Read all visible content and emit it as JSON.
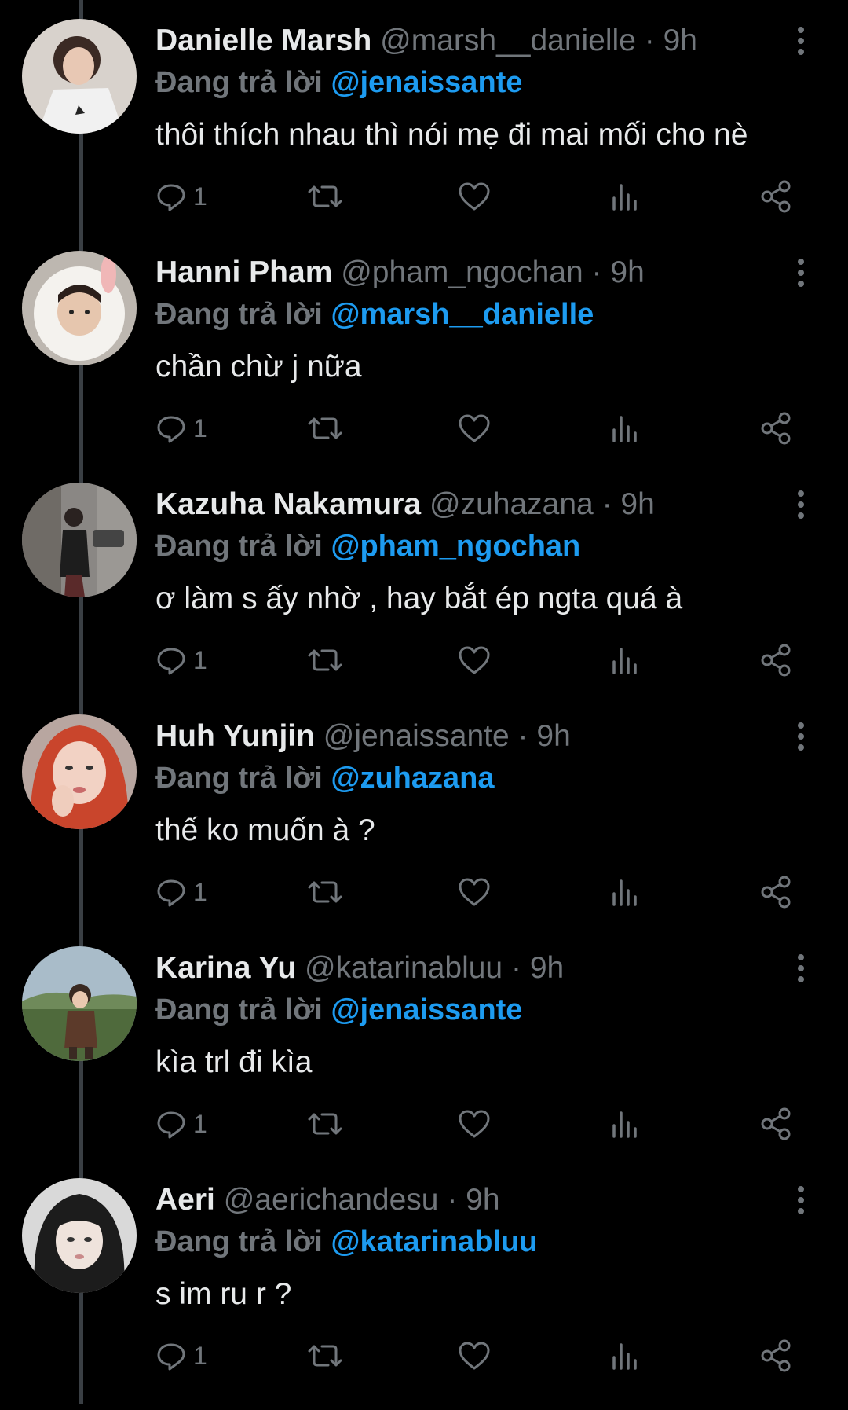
{
  "colors": {
    "background": "#000000",
    "text": "#e7e9ea",
    "muted": "#71767b",
    "accent": "#1d9bf0",
    "thread_line": "#3a3f44"
  },
  "replying_prefix": "Đang trả lời",
  "tweets": [
    {
      "name": "Danielle Marsh",
      "handle": "@marsh__danielle",
      "dot": "·",
      "time": "9h",
      "reply_to": "@jenaissante",
      "text": "thôi thích nhau thì nói mẹ đi mai mối cho nè",
      "reply_count": "1"
    },
    {
      "name": "Hanni Pham",
      "handle": "@pham_ngochan",
      "dot": "·",
      "time": "9h",
      "reply_to": "@marsh__danielle",
      "text": "chần chừ j nữa",
      "reply_count": "1"
    },
    {
      "name": "Kazuha Nakamura",
      "handle": "@zuhazana",
      "dot": "·",
      "time": "9h",
      "reply_to": "@pham_ngochan",
      "text": "ơ làm s ấy nhờ , hay bắt ép ngta quá à",
      "reply_count": "1"
    },
    {
      "name": "Huh Yunjin",
      "handle": " @jenaissante",
      "dot": "·",
      "time": "9h",
      "reply_to": "@zuhazana",
      "text": "thế ko muốn à ?",
      "reply_count": "1"
    },
    {
      "name": "Karina Yu",
      "handle": "@katarinabluu",
      "dot": "·",
      "time": "9h",
      "reply_to": "@jenaissante",
      "text": "kìa trl đi kìa",
      "reply_count": "1"
    },
    {
      "name": "Aeri",
      "handle": "@aerichandesu",
      "dot": "·",
      "time": "9h",
      "reply_to": "@katarinabluu",
      "text": "s im ru r ?",
      "reply_count": "1"
    }
  ],
  "icons": {
    "reply": "reply-icon",
    "retweet": "retweet-icon",
    "like": "heart-icon",
    "views": "views-chart-icon",
    "share": "share-icon",
    "more": "more-vertical-icon",
    "avatar": "avatar-photo"
  }
}
